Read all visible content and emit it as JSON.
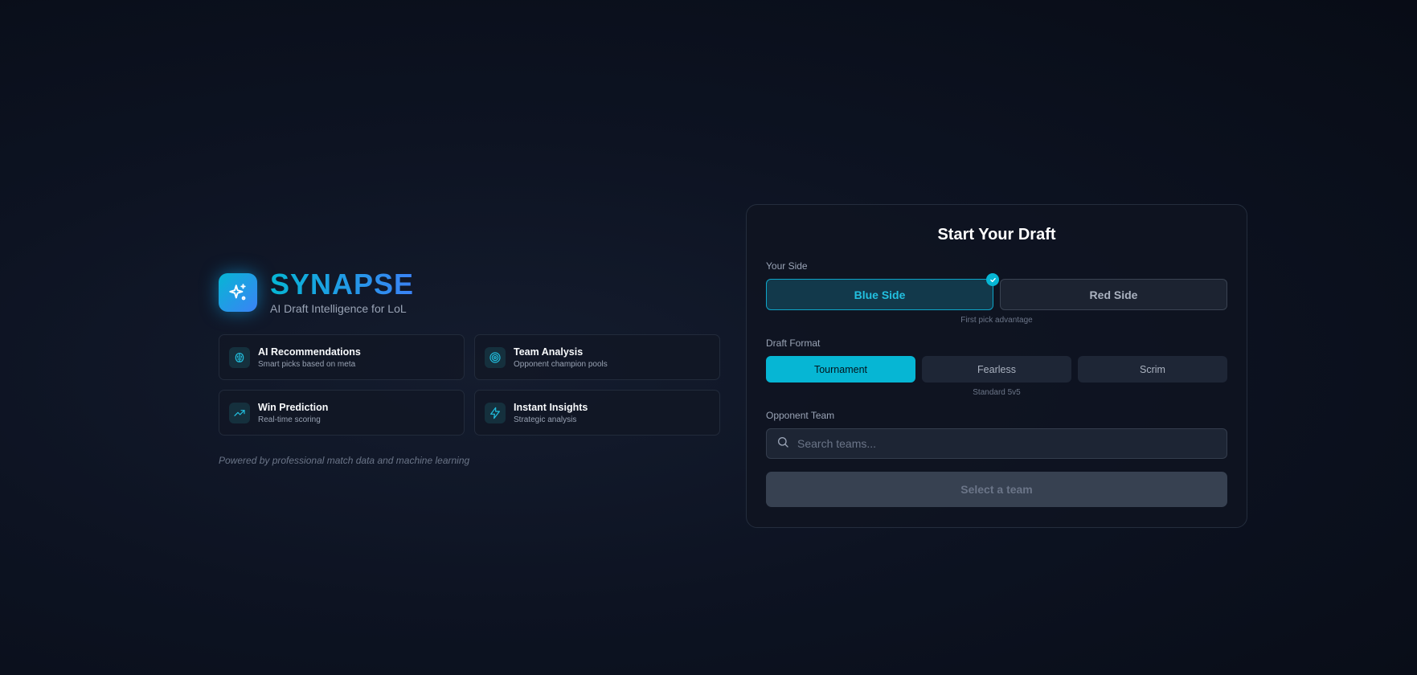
{
  "brand": {
    "title": "SYNAPSE",
    "subtitle": "AI Draft Intelligence for LoL",
    "logo_icon": "sparkles-icon"
  },
  "features": [
    {
      "title": "AI Recommendations",
      "desc": "Smart picks based on meta",
      "icon": "brain-icon"
    },
    {
      "title": "Team Analysis",
      "desc": "Opponent champion pools",
      "icon": "target-icon"
    },
    {
      "title": "Win Prediction",
      "desc": "Real-time scoring",
      "icon": "trending-up-icon"
    },
    {
      "title": "Instant Insights",
      "desc": "Strategic analysis",
      "icon": "lightning-icon"
    }
  ],
  "powered_by": "Powered by professional match data and machine learning",
  "draft": {
    "title": "Start Your Draft",
    "side": {
      "label": "Your Side",
      "options": [
        "Blue Side",
        "Red Side"
      ],
      "selected": "Blue Side",
      "hint": "First pick advantage"
    },
    "format": {
      "label": "Draft Format",
      "options": [
        "Tournament",
        "Fearless",
        "Scrim"
      ],
      "selected": "Tournament",
      "hint": "Standard 5v5"
    },
    "opponent": {
      "label": "Opponent Team",
      "placeholder": "Search teams...",
      "value": ""
    },
    "submit_label": "Select a team"
  },
  "colors": {
    "accent": "#06b6d4",
    "accent_secondary": "#3b82f6",
    "background": "#0d1322"
  }
}
